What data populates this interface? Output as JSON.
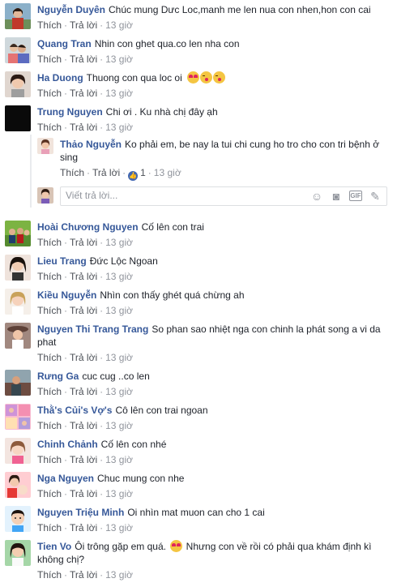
{
  "ui": {
    "like": "Thích",
    "reply": "Trả lời",
    "reply_placeholder": "Viết trả lời..."
  },
  "comments": [
    {
      "name": "Nguyễn Duyên",
      "text": "Chúc mung Dưc Loc,manh me len nua con nhen,hon con cai",
      "time": "13 giờ",
      "avatar": "woman-outdoor"
    },
    {
      "name": "Quang Tran",
      "text": "Nhin con ghet qua.co len nha con",
      "time": "13 giờ",
      "avatar": "couple"
    },
    {
      "name": "Ha Duong",
      "text": "Thuong con qua loc oi",
      "time": "13 giờ",
      "avatar": "woman-portrait",
      "emojis": [
        "heart-eyes-icon",
        "kiss-icon",
        "kiss-icon"
      ]
    },
    {
      "name": "Trung Nguyen",
      "text": "Chi ơi . Ku nhà chị đây ạh",
      "time": "13 giờ",
      "avatar": "dark"
    },
    {
      "name": "Hoài Chương Nguyen",
      "text": "Cố lên con trai",
      "time": "13 giờ",
      "avatar": "group-green"
    },
    {
      "name": "Lieu Trang",
      "text": "Đức Lộc Ngoan",
      "time": "13 giờ",
      "avatar": "woman-dark-hair"
    },
    {
      "name": "Kiều Nguyễn",
      "text": "Nhìn con thấy ghét quá chừng ah",
      "time": "13 giờ",
      "avatar": "woman-blonde"
    },
    {
      "name": "Nguyen Thi Trang Trang",
      "text": "So phan sao nhiệt nga con chinh la phát song a vi da phat",
      "time": "13 giờ",
      "avatar": "woman-hat"
    },
    {
      "name": "Rưng Ga",
      "text": "cuc cug ..co len",
      "time": "13 giờ",
      "avatar": "nature"
    },
    {
      "name": "Thằ's Củi's Vợ's",
      "text": "Cô lên con trai ngoan",
      "time": "13 giờ",
      "avatar": "collage"
    },
    {
      "name": "Chinh Chảnh",
      "text": "Cố lên con nhé",
      "time": "13 giờ",
      "avatar": "woman-light"
    },
    {
      "name": "Nga Nguyen",
      "text": "Chuc mung con nhe",
      "time": "13 giờ",
      "avatar": "mother-baby"
    },
    {
      "name": "Nguyen Triệu Minh",
      "text": "Oi nhìn mat muon can cho 1 cai",
      "time": "13 giờ",
      "avatar": "child"
    },
    {
      "name": "Tien Vo",
      "text": "Ôi trông gặp em quá.",
      "text2": "Nhưng con về rồi có phải qua khám định kì không chị?",
      "time": "13 giờ",
      "avatar": "woman-green",
      "emojis": [
        "heart-eyes-icon"
      ]
    }
  ],
  "reply": {
    "name": "Thảo Nguyễn",
    "text": "Ko phải em, be nay la tui chi cung ho tro cho con tri bệnh ở sing",
    "time": "13 giờ",
    "likes": "1",
    "avatar": "woman-small"
  }
}
